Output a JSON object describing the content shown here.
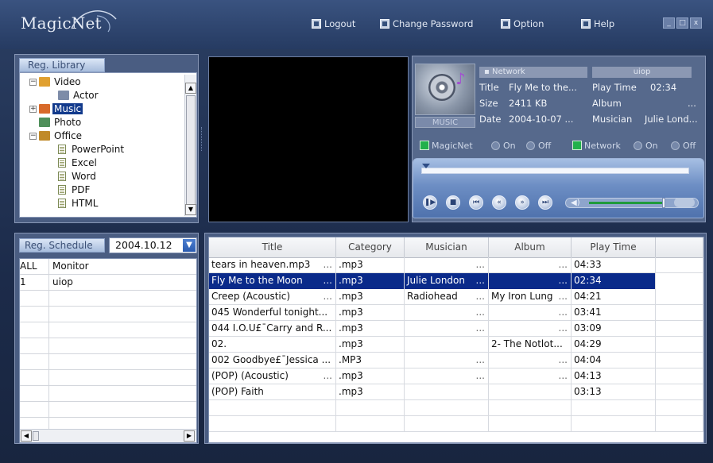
{
  "app": {
    "logo": "MagicNet"
  },
  "topbar": {
    "logout": "Logout",
    "change_password": "Change Password",
    "option": "Option",
    "help": "Help",
    "win_minimize": "_",
    "win_restore": "□",
    "win_close": "x"
  },
  "library": {
    "tab_label": "Reg. Library",
    "tree": [
      {
        "label": "Video",
        "level": 0,
        "expander": "-",
        "icon": "video-folder-icon"
      },
      {
        "label": "Actor",
        "level": 1,
        "expander": "",
        "icon": "actor-icon"
      },
      {
        "label": "Music",
        "level": 0,
        "expander": "+",
        "icon": "music-folder-icon",
        "selected": true
      },
      {
        "label": "Photo",
        "level": 0,
        "expander": "",
        "icon": "photo-folder-icon"
      },
      {
        "label": "Office",
        "level": 0,
        "expander": "-",
        "icon": "office-folder-icon"
      },
      {
        "label": "PowerPoint",
        "level": 1,
        "expander": "",
        "icon": "document-icon"
      },
      {
        "label": "Excel",
        "level": 1,
        "expander": "",
        "icon": "document-icon"
      },
      {
        "label": "Word",
        "level": 1,
        "expander": "",
        "icon": "document-icon"
      },
      {
        "label": "PDF",
        "level": 1,
        "expander": "",
        "icon": "document-icon"
      },
      {
        "label": "HTML",
        "level": 1,
        "expander": "",
        "icon": "document-icon"
      }
    ]
  },
  "info": {
    "album_art_label": "MUSIC",
    "network_bar": "Network",
    "user_bar": "uiop",
    "title_label": "Title",
    "title_value": "Fly Me to the...",
    "size_label": "Size",
    "size_value": "2411 KB",
    "date_label": "Date",
    "date_value": "2004-10-07 ...",
    "playtime_label": "Play Time",
    "playtime_value": "02:34",
    "album_label": "Album",
    "album_value": "...",
    "musician_label": "Musician",
    "musician_value": "Julie Lond..."
  },
  "toggles": {
    "magicnet_label": "MagicNet",
    "network_label": "Network",
    "on": "On",
    "off": "Off"
  },
  "player": {
    "seek_position": 0,
    "volume_level": 0.8,
    "buttons": [
      "play-pause",
      "stop",
      "previous",
      "rewind",
      "fast-forward",
      "next"
    ]
  },
  "schedule": {
    "tab_label": "Reg. Schedule",
    "date": "2004.10.12",
    "rows": [
      {
        "id": "ALL",
        "name": "Monitor"
      },
      {
        "id": "1",
        "name": "uiop"
      }
    ]
  },
  "playlist": {
    "headers": [
      "Title",
      "Category",
      "Musician",
      "Album",
      "Play Time"
    ],
    "rows": [
      {
        "title": "tears in heaven.mp3",
        "title_more": true,
        "category": ".mp3",
        "musician": "",
        "musician_more": true,
        "album": "",
        "album_more": true,
        "time": "04:33"
      },
      {
        "title": "Fly Me to the Moon",
        "title_more": true,
        "category": ".mp3",
        "musician": "Julie London",
        "musician_more": true,
        "album": "",
        "album_more": true,
        "time": "02:34",
        "selected": true
      },
      {
        "title": "Creep (Acoustic)",
        "title_more": true,
        "category": ".mp3",
        "musician": "Radiohead",
        "musician_more": true,
        "album": "My Iron Lung",
        "album_more": true,
        "time": "04:21"
      },
      {
        "title": "045 Wonderful tonight...",
        "title_more": false,
        "category": ".mp3",
        "musician": "",
        "musician_more": true,
        "album": "",
        "album_more": true,
        "time": "03:41"
      },
      {
        "title": "044 I.O.U£¯Carry and R...",
        "title_more": false,
        "category": ".mp3",
        "musician": "",
        "musician_more": true,
        "album": "",
        "album_more": true,
        "time": "03:09"
      },
      {
        "title": "02.",
        "title_more": false,
        "category": ".mp3",
        "musician": "",
        "musician_more": false,
        "album": "2- The Notlot...",
        "album_more": false,
        "time": "04:29"
      },
      {
        "title": "002 Goodbye£¯Jessica ...",
        "title_more": false,
        "category": ".MP3",
        "musician": "",
        "musician_more": true,
        "album": "",
        "album_more": true,
        "time": "04:04"
      },
      {
        "title": "(POP) (Acoustic)",
        "title_more": true,
        "category": ".mp3",
        "musician": "",
        "musician_more": true,
        "album": "",
        "album_more": true,
        "time": "04:13"
      },
      {
        "title": "(POP) Faith",
        "title_more": false,
        "category": ".mp3",
        "musician": "",
        "musician_more": false,
        "album": "",
        "album_more": false,
        "time": "03:13"
      }
    ]
  },
  "colors": {
    "selection": "#0a2a8a",
    "accent_green": "#23b04c",
    "frame_blue": "#4a5d82"
  }
}
